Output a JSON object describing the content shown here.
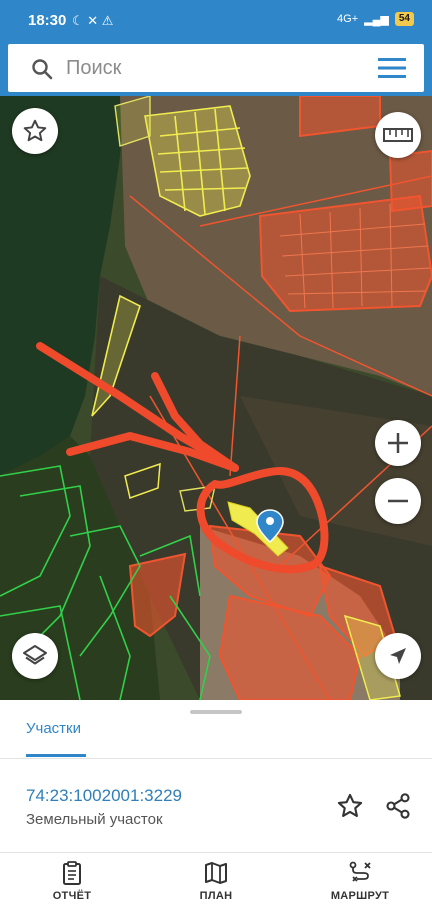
{
  "status_bar": {
    "time": "18:30",
    "battery": "54",
    "network": "4G+"
  },
  "search": {
    "placeholder": "Поиск"
  },
  "map": {
    "controls": {
      "favorite": "star-icon",
      "ruler": "ruler-icon",
      "zoom_in": "plus-icon",
      "zoom_out": "minus-icon",
      "layers": "layers-icon",
      "locate": "navigation-arrow-icon"
    }
  },
  "sheet": {
    "tab_label": "Участки",
    "parcel": {
      "number": "74:23:1002001:3229",
      "type": "Земельный участок"
    }
  },
  "bottom_nav": {
    "items": [
      {
        "label": "ОТЧЁТ",
        "icon": "report-icon"
      },
      {
        "label": "ПЛАН",
        "icon": "map-plan-icon"
      },
      {
        "label": "МАРШРУТ",
        "icon": "route-icon"
      }
    ]
  },
  "colors": {
    "brand": "#2f86c9",
    "parcel_red": "#f0552f",
    "parcel_yellow": "#f0ec50",
    "parcel_green": "#32d04a",
    "annotation": "#ee4a2b"
  }
}
